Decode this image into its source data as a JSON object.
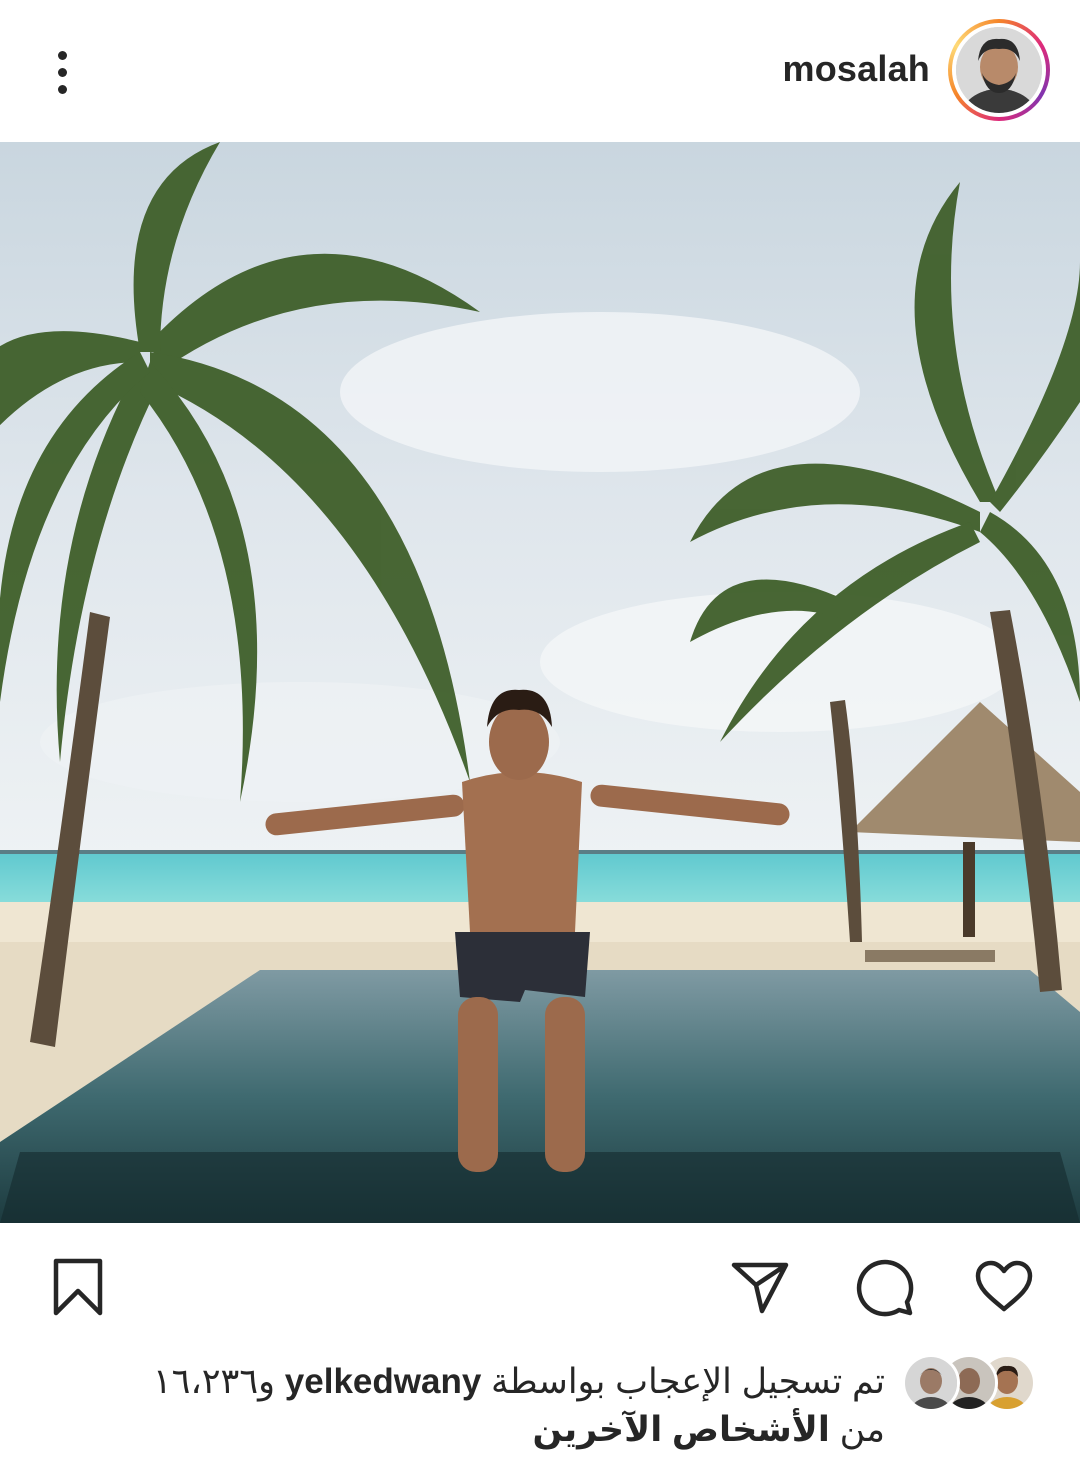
{
  "header": {
    "username": "mosalah",
    "menu_icon": "more-vertical-icon",
    "avatar_icon": "profile-avatar"
  },
  "post": {
    "image_alt": "Man standing with arms outstretched in an infinity pool surrounded by palm trees on a tropical beach"
  },
  "actions": {
    "like_icon": "heart-icon",
    "comment_icon": "comment-icon",
    "share_icon": "send-icon",
    "save_icon": "bookmark-icon"
  },
  "likes": {
    "prefix": "تم تسجيل الإعجاب بواسطة",
    "liker": "yelkedwany",
    "middle": "و١٦،٢٣٦ من",
    "others": "الأشخاص الآخرين"
  },
  "colors": {
    "text": "#262626",
    "ring_start": "#f58529",
    "ring_mid": "#dd2a7b",
    "ring_end": "#8134af"
  }
}
